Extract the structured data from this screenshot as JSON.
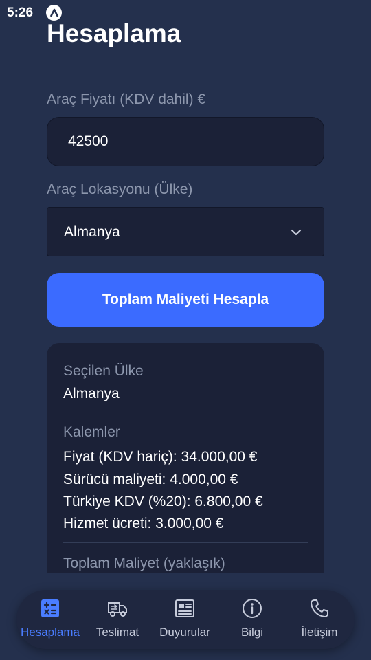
{
  "status_bar": {
    "time": "5:26",
    "app_icon": "a-logo-icon"
  },
  "page": {
    "title": "Hesaplama"
  },
  "form": {
    "price_label": "Araç Fiyatı (KDV dahil) €",
    "price_value": "42500",
    "location_label": "Araç Lokasyonu (Ülke)",
    "location_value": "Almanya",
    "calculate_button": "Toplam Maliyeti Hesapla"
  },
  "result": {
    "selected_country_label": "Seçilen Ülke",
    "selected_country_value": "Almanya",
    "items_label": "Kalemler",
    "items": [
      "Fiyat (KDV hariç): 34.000,00 €",
      "Sürücü maliyeti: 4.000,00 €",
      "Türkiye KDV (%20): 6.800,00 €",
      "Hizmet ücreti: 3.000,00 €"
    ],
    "total_label": "Toplam Maliyet (yaklaşık)"
  },
  "bottom_nav": {
    "active_color": "#4a7dff",
    "items": [
      {
        "label": "Hesaplama",
        "icon": "calculator-icon",
        "active": true
      },
      {
        "label": "Teslimat",
        "icon": "truck-icon",
        "active": false
      },
      {
        "label": "Duyurular",
        "icon": "newspaper-icon",
        "active": false
      },
      {
        "label": "Bilgi",
        "icon": "info-icon",
        "active": false
      },
      {
        "label": "İletişim",
        "icon": "phone-icon",
        "active": false
      }
    ]
  },
  "colors": {
    "background": "#24304d",
    "card": "#1b2137",
    "accent": "#3b6bff",
    "muted_text": "#8d97ad"
  }
}
